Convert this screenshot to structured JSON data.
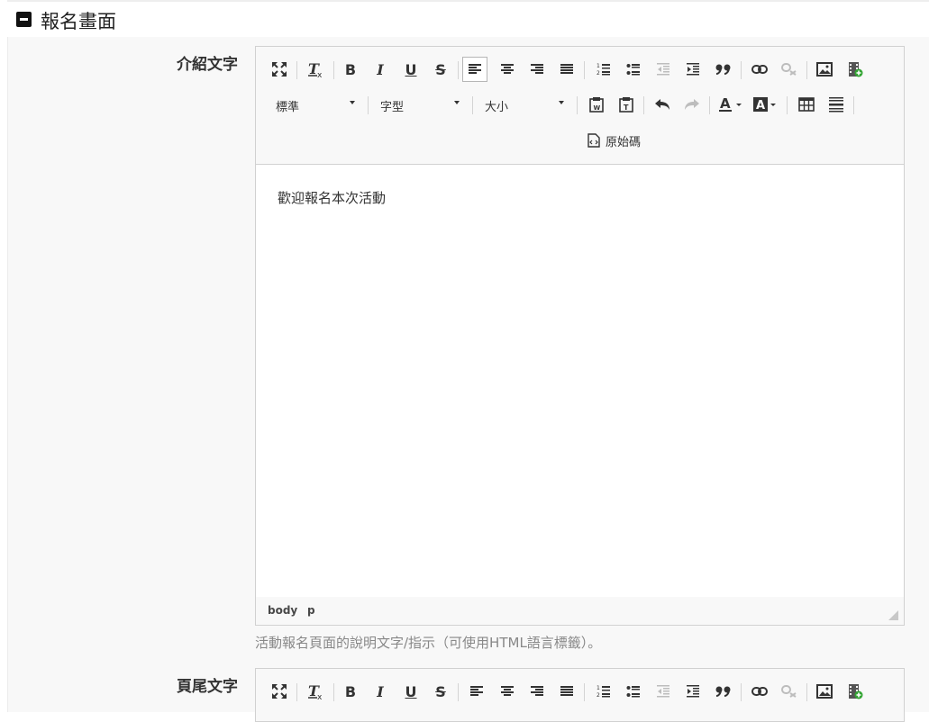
{
  "section": {
    "title": "報名畫面"
  },
  "fields": [
    {
      "label": "介紹文字",
      "toolbar": {
        "format_combo": "標準",
        "font_combo": "字型",
        "size_combo": "大小",
        "source_label": "原始碼"
      },
      "content": "歡迎報名本次活動",
      "path": [
        "body",
        "p"
      ],
      "help": "活動報名頁面的說明文字/指示（可使用HTML語言標籤）。"
    },
    {
      "label": "頁尾文字"
    }
  ],
  "toolbar_icons_row1": [
    "maximize-icon",
    "remove-format-icon",
    "bold-icon",
    "italic-icon",
    "underline-icon",
    "strikethrough-icon",
    "align-left-icon",
    "align-center-icon",
    "align-right-icon",
    "align-justify-icon",
    "numbered-list-icon",
    "bulleted-list-icon",
    "outdent-icon",
    "indent-icon",
    "blockquote-icon",
    "link-icon",
    "unlink-icon",
    "image-icon",
    "video-icon"
  ],
  "toolbar_icons_row2": [
    "paste-from-word-icon",
    "paste-as-text-icon",
    "undo-icon",
    "redo-icon",
    "text-color-icon",
    "background-color-icon",
    "table-icon",
    "horizontal-rule-icon"
  ],
  "colors": {
    "header_bg": "#ffffff",
    "body_bg": "#f8f8f8",
    "editor_border": "#d1d1d1",
    "help_text": "#888888",
    "video_icon_accent": "#35a535"
  }
}
